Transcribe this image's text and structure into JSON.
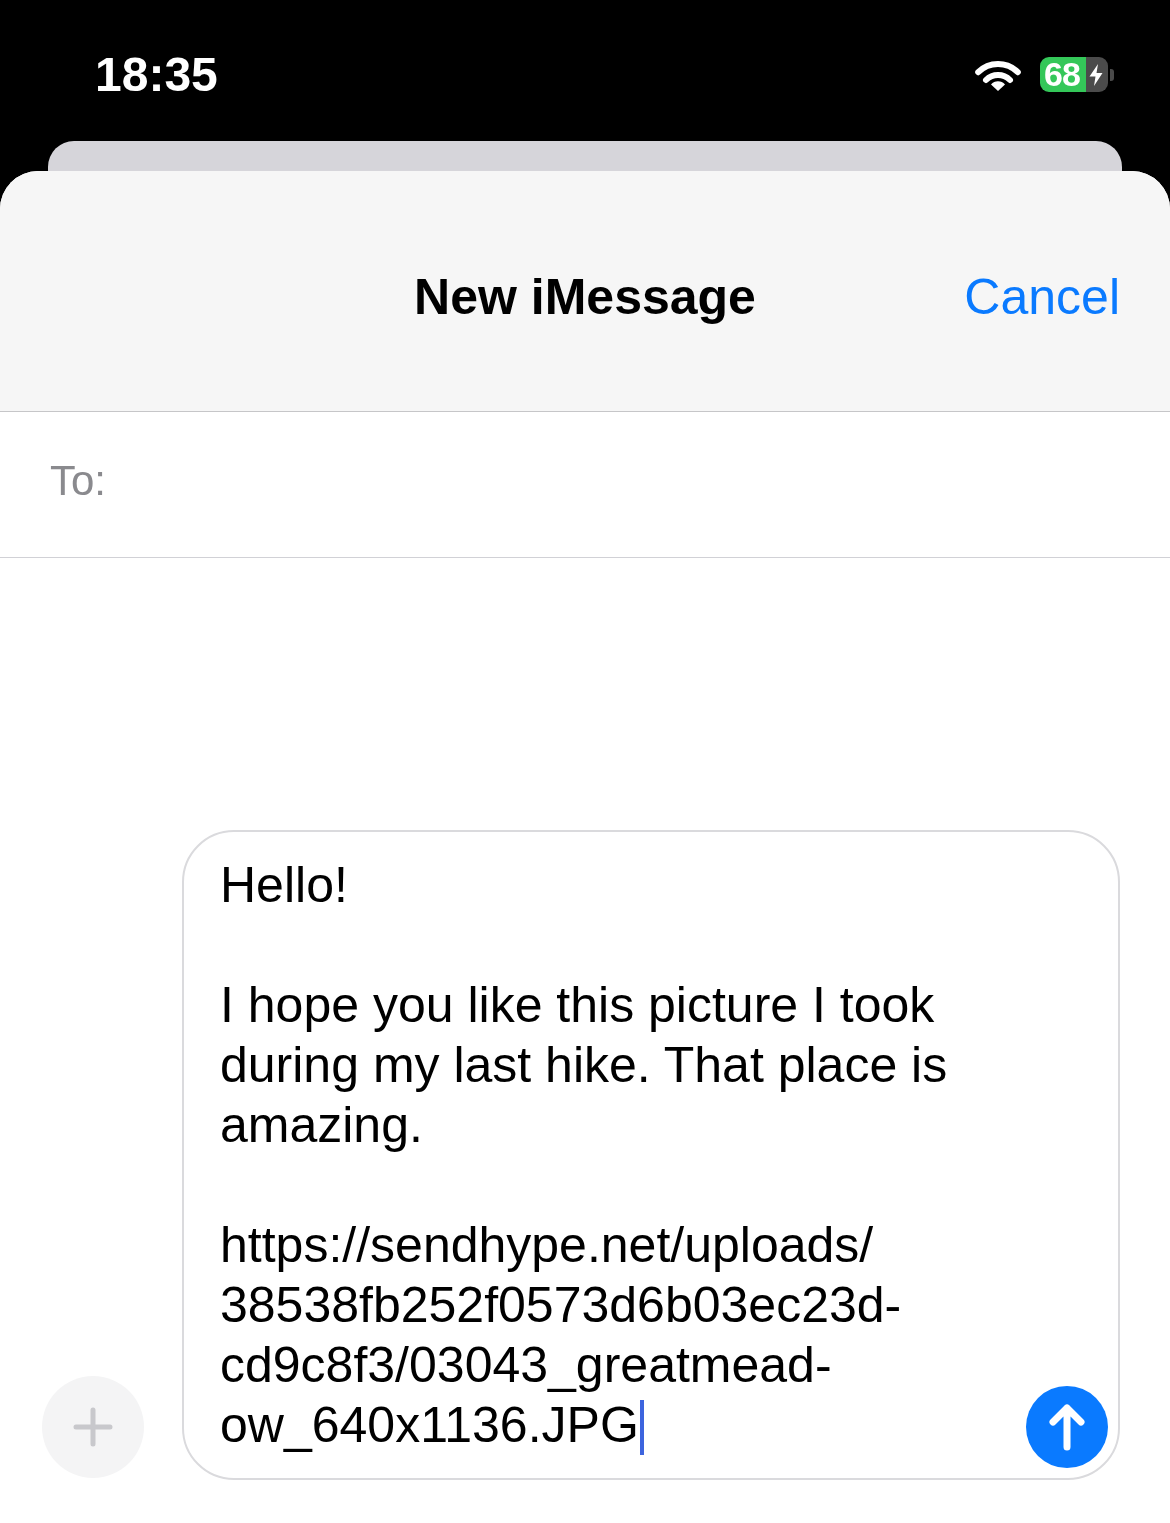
{
  "status_bar": {
    "time": "18:35",
    "battery": "68",
    "charging": true
  },
  "header": {
    "title": "New iMessage",
    "cancel": "Cancel"
  },
  "recipients": {
    "label": "To:"
  },
  "composer": {
    "value": "Hello!\n\nI hope you like this picture I took\nduring my last hike. That place is\namazing.\n\nhttps://sendhype.net/uploads/\n38538fb252f0573d6b03ec23d-\ncd9c8f3/03043_greatmead-\now_640x1136.JPG",
    "focused": true
  }
}
